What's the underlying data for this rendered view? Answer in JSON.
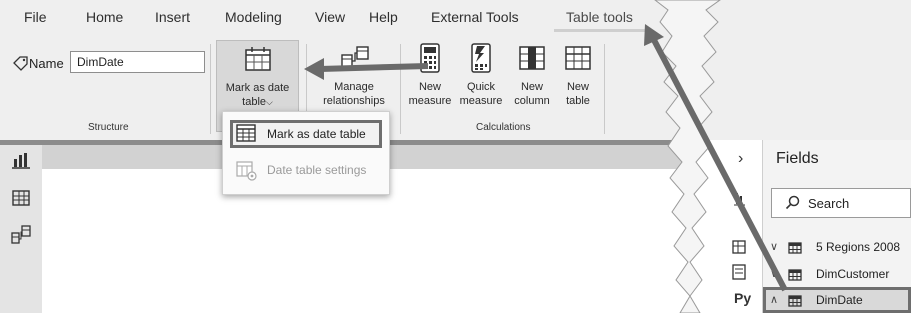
{
  "menu": {
    "tabs": [
      {
        "label": "File"
      },
      {
        "label": "Home"
      },
      {
        "label": "Insert"
      },
      {
        "label": "Modeling"
      },
      {
        "label": "View"
      },
      {
        "label": "Help"
      },
      {
        "label": "External Tools"
      },
      {
        "label": "Table tools"
      }
    ],
    "active_tab": "Table tools"
  },
  "ribbon": {
    "structure": {
      "name_label": "Name",
      "name_value": "DimDate",
      "group_label": "Structure"
    },
    "buttons": {
      "mark_as_date_line1": "Mark as date",
      "mark_as_date_line2": "table",
      "manage_rel_line1": "Manage",
      "manage_rel_line2": "relationships",
      "new_measure_line1": "New",
      "new_measure_line2": "measure",
      "quick_measure_line1": "Quick",
      "quick_measure_line2": "measure",
      "new_column_line1": "New",
      "new_column_line2": "column",
      "new_table_line1": "New",
      "new_table_line2": "table"
    },
    "calculations_label": "Calculations"
  },
  "dropdown": {
    "items": [
      {
        "label": "Mark as date table",
        "enabled": true
      },
      {
        "label": "Date table settings",
        "enabled": false
      }
    ]
  },
  "fields": {
    "title": "Fields",
    "search_placeholder": "Search",
    "tables": [
      {
        "name": "5 Regions 2008",
        "expanded": false
      },
      {
        "name": "DimCustomer",
        "expanded": false
      },
      {
        "name": "DimDate",
        "expanded": true
      }
    ]
  },
  "side_labels": {
    "py": "Py"
  },
  "colors": {
    "highlight_border": "#6e6e6e",
    "annotation_arrow": "#6a6a6a"
  }
}
